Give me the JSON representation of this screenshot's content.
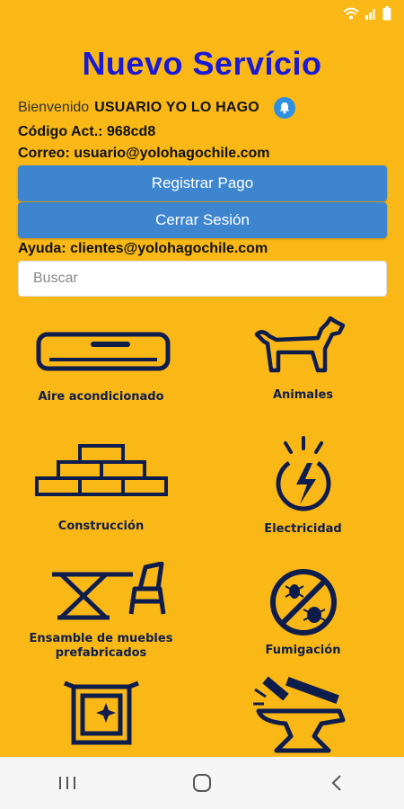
{
  "title": "Nuevo Servício",
  "welcome": {
    "prefix": "Bienvenido",
    "user": "USUARIO YO LO HAGO"
  },
  "code_line": "Código Act.: 968cd8",
  "email_line": "Correo: usuario@yolohagochile.com",
  "buttons": {
    "pay": "Registrar Pago",
    "logout": "Cerrar Sesión"
  },
  "help_line": "Ayuda: clientes@yolohagochile.com",
  "search": {
    "placeholder": "Buscar",
    "value": ""
  },
  "categories": [
    {
      "label": "Aire acondicionado",
      "icon": "air-conditioner-icon"
    },
    {
      "label": "Animales",
      "icon": "dog-icon"
    },
    {
      "label": "Construcción",
      "icon": "bricks-icon"
    },
    {
      "label": "Electricidad",
      "icon": "electricity-icon"
    },
    {
      "label": "Ensamble de muebles prefabricados",
      "icon": "furniture-icon"
    },
    {
      "label": "Fumigación",
      "icon": "no-bugs-icon"
    },
    {
      "label": "",
      "icon": "frame-cleaning-icon"
    },
    {
      "label": "",
      "icon": "anvil-hammer-icon"
    }
  ],
  "colors": {
    "background": "#F9B816",
    "title": "#1a1ad6",
    "button": "#3d86cf",
    "icon": "#0f1d4d"
  }
}
